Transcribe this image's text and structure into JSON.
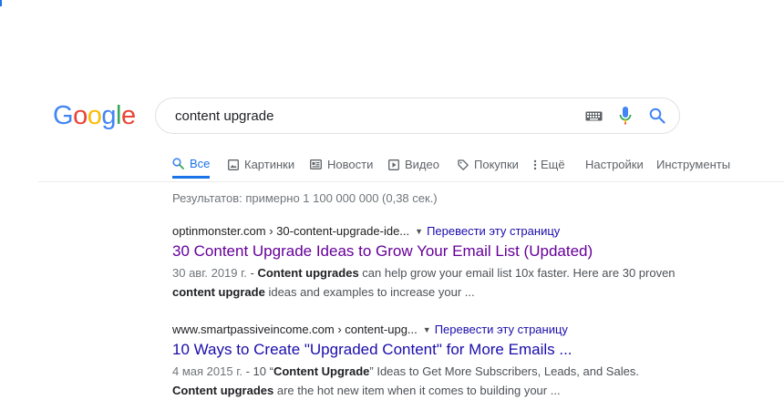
{
  "logo": {
    "letters": [
      {
        "ch": "G",
        "color": "#4285F4"
      },
      {
        "ch": "o",
        "color": "#EA4335"
      },
      {
        "ch": "o",
        "color": "#FBBC05"
      },
      {
        "ch": "g",
        "color": "#4285F4"
      },
      {
        "ch": "l",
        "color": "#34A853"
      },
      {
        "ch": "e",
        "color": "#EA4335"
      }
    ]
  },
  "search": {
    "query": "content upgrade",
    "icons": [
      "keyboard-icon",
      "microphone-icon",
      "search-icon"
    ]
  },
  "tabs": {
    "all": "Все",
    "images": "Картинки",
    "news": "Новости",
    "video": "Видео",
    "shopping": "Покупки",
    "more": "Ещё",
    "settings": "Настройки",
    "tools": "Инструменты"
  },
  "stats": "Результатов: примерно 1 100 000 000 (0,38 сек.)",
  "results": [
    {
      "cite": "optinmonster.com › 30-content-upgrade-ide...",
      "translate": "Перевести эту страницу",
      "title": "30 Content Upgrade Ideas to Grow Your Email List (Updated)",
      "date": "30 авг. 2019 г.",
      "snippet_parts": [
        " - ",
        "Content upgrades",
        " can help grow your email list 10x faster. Here are 30 proven",
        "content upgrade",
        " ideas and examples to increase your ..."
      ]
    },
    {
      "cite": "www.smartpassiveincome.com › content-upg...",
      "translate": "Перевести эту страницу",
      "title": "10 Ways to Create \"Upgraded Content\" for More Emails ...",
      "date": "4 мая 2015 г.",
      "snippet_parts": [
        " - 10 “",
        "Content Upgrade",
        "” Ideas to Get More Subscribers, Leads, and Sales.",
        "Content upgrades",
        " are the hot new item when it comes to building your ..."
      ]
    }
  ],
  "colors": {
    "link": "#1a0dab",
    "visited": "#660099",
    "accent": "#1a73e8"
  }
}
